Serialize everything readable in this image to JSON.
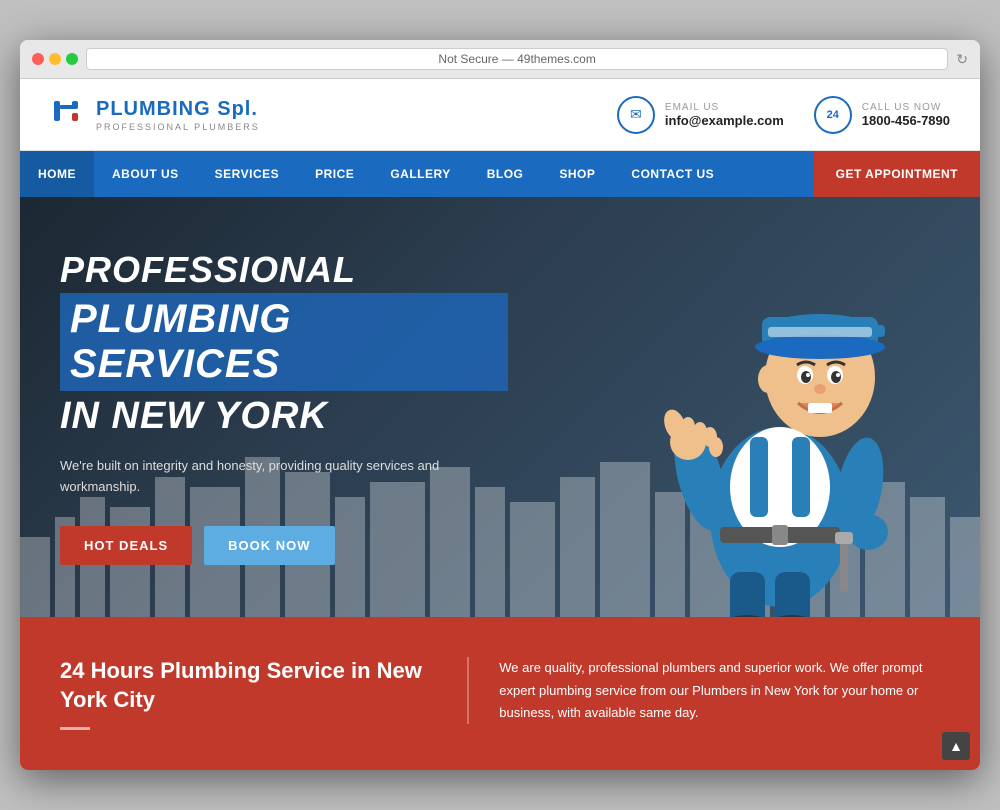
{
  "browser": {
    "address": "Not Secure — 49themes.com",
    "reload_label": "↻"
  },
  "header": {
    "logo_text": "PLUMBING",
    "logo_accent": "Spl.",
    "logo_sub": "PROFESSIONAL PLUMBERS",
    "email_label": "EMAIL US",
    "email_value": "info@example.com",
    "phone_label": "CALL US NOW",
    "phone_value": "1800-456-7890",
    "phone_circle": "24"
  },
  "nav": {
    "items": [
      {
        "label": "HOME",
        "active": true
      },
      {
        "label": "ABOUT US",
        "active": false
      },
      {
        "label": "SERVICES",
        "active": false
      },
      {
        "label": "PRICE",
        "active": false
      },
      {
        "label": "GALLERY",
        "active": false
      },
      {
        "label": "BLOG",
        "active": false
      },
      {
        "label": "SHOP",
        "active": false
      },
      {
        "label": "CONTACT US",
        "active": false
      }
    ],
    "cta_label": "GET APPOINTMENT"
  },
  "hero": {
    "title_line1": "PROFESSIONAL",
    "title_line2": "PLUMBING SERVICES",
    "title_line3": "IN NEW YORK",
    "description": "We're built on integrity and honesty, providing quality services and workmanship.",
    "btn_hot": "HOT DEALS",
    "btn_book": "BOOK NOW"
  },
  "bottom": {
    "title": "24 Hours Plumbing Service in New York City",
    "description": "We are quality, professional plumbers and superior work. We offer prompt expert plumbing service from our Plumbers in New York for your home or business, with available same day."
  },
  "icons": {
    "email": "✉",
    "phone": "📞",
    "scroll_up": "▲",
    "logo_pipe": "🔧"
  }
}
